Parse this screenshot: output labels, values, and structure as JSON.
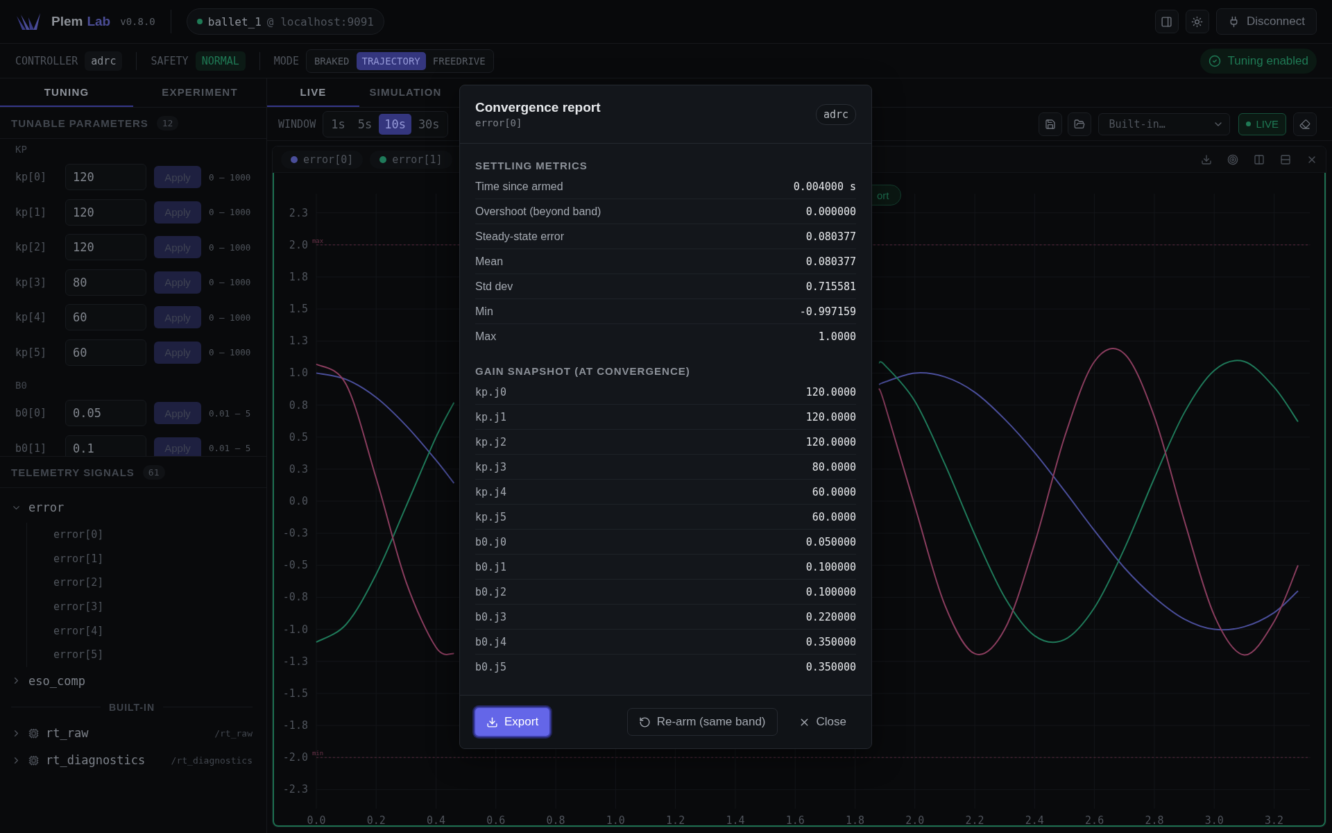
{
  "header": {
    "brand": "Plem",
    "brand_accent": "Lab",
    "version": "v0.8.0",
    "connection": {
      "robot": "ballet_1",
      "separator": "@",
      "host": "localhost:9091",
      "connected": true
    },
    "disconnect": "Disconnect"
  },
  "status_bar": {
    "controller_label": "CONTROLLER",
    "controller": "adrc",
    "safety_label": "SAFETY",
    "safety": "NORMAL",
    "mode_label": "MODE",
    "modes": [
      {
        "label": "BRAKED",
        "selected": false
      },
      {
        "label": "TRAJECTORY",
        "selected": true
      },
      {
        "label": "FREEDRIVE",
        "selected": false
      }
    ],
    "tuning": {
      "label": "Tuning enabled",
      "on": true
    }
  },
  "sidebar": {
    "tabs": [
      {
        "label": "TUNING",
        "selected": true
      },
      {
        "label": "EXPERIMENT",
        "selected": false
      }
    ],
    "parameters": {
      "title": "TUNABLE PARAMETERS",
      "count": "12",
      "groups": [
        {
          "label": "KP",
          "items": [
            {
              "name": "kp[0]",
              "value": "120",
              "button": "Apply",
              "disabled": true,
              "range": "0 – 1000"
            },
            {
              "name": "kp[1]",
              "value": "120",
              "button": "Apply",
              "disabled": true,
              "range": "0 – 1000"
            },
            {
              "name": "kp[2]",
              "value": "120",
              "button": "Apply",
              "disabled": true,
              "range": "0 – 1000"
            },
            {
              "name": "kp[3]",
              "value": "80",
              "button": "Apply",
              "disabled": true,
              "range": "0 – 1000"
            },
            {
              "name": "kp[4]",
              "value": "60",
              "button": "Apply",
              "disabled": true,
              "range": "0 – 1000"
            },
            {
              "name": "kp[5]",
              "value": "60",
              "button": "Apply",
              "disabled": true,
              "range": "0 – 1000"
            }
          ]
        },
        {
          "label": "B0",
          "items": [
            {
              "name": "b0[0]",
              "value": "0.05",
              "button": "Apply",
              "disabled": true,
              "range": "0.01 – 5"
            },
            {
              "name": "b0[1]",
              "value": "0.1",
              "button": "Apply",
              "disabled": true,
              "range": "0.01 – 5"
            }
          ]
        }
      ]
    },
    "signals": {
      "title": "TELEMETRY SIGNALS",
      "count": "61",
      "groups": [
        {
          "label": "error",
          "expanded": true,
          "children": [
            {
              "label": "error[0]"
            },
            {
              "label": "error[1]"
            },
            {
              "label": "error[2]"
            },
            {
              "label": "error[3]"
            },
            {
              "label": "error[4]"
            },
            {
              "label": "error[5]"
            }
          ]
        },
        {
          "label": "eso_comp",
          "expanded": false
        }
      ],
      "builtin_label": "BUILT-IN",
      "builtin": [
        {
          "label": "rt_raw",
          "path": "/rt_raw",
          "expanded": false
        },
        {
          "label": "rt_diagnostics",
          "path": "/rt_diagnostics",
          "expanded": false
        }
      ]
    }
  },
  "main": {
    "tabs": [
      {
        "label": "LIVE",
        "selected": true
      },
      {
        "label": "SIMULATION",
        "selected": false
      }
    ],
    "toolbar": {
      "window_label": "WINDOW",
      "windows": [
        {
          "label": "1s",
          "selected": false
        },
        {
          "label": "5s",
          "selected": false
        },
        {
          "label": "10s",
          "selected": true
        },
        {
          "label": "30s",
          "selected": false
        }
      ],
      "preset": "Built-in…",
      "live": {
        "label": "LIVE",
        "on": true
      }
    },
    "chart": {
      "badge": "ort",
      "chart_data": {
        "type": "line",
        "xlim": [
          0,
          3.32
        ],
        "ylim": [
          -2.4,
          2.4
        ],
        "xticks": [
          {
            "value": 0,
            "label": "0.0"
          },
          {
            "value": 0.2,
            "label": "0.2"
          },
          {
            "value": 0.4,
            "label": "0.4"
          },
          {
            "value": 0.6,
            "label": "0.6"
          },
          {
            "value": 0.8,
            "label": "0.8"
          },
          {
            "value": 1,
            "label": "1.0"
          },
          {
            "value": 1.2,
            "label": "1.2"
          },
          {
            "value": 1.4,
            "label": "1.4"
          },
          {
            "value": 1.6,
            "label": "1.6"
          },
          {
            "value": 1.8,
            "label": "1.8"
          },
          {
            "value": 2,
            "label": "2.0"
          },
          {
            "value": 2.2,
            "label": "2.2"
          },
          {
            "value": 2.4,
            "label": "2.4"
          },
          {
            "value": 2.6,
            "label": "2.6"
          },
          {
            "value": 2.8,
            "label": "2.8"
          },
          {
            "value": 3,
            "label": "3.0"
          },
          {
            "value": 3.2,
            "label": "3.2"
          }
        ],
        "yticks": [
          {
            "value": 2.25,
            "label": "2.3"
          },
          {
            "value": 2,
            "label": "2.0"
          },
          {
            "value": 1.75,
            "label": "1.8"
          },
          {
            "value": 1.5,
            "label": "1.5"
          },
          {
            "value": 1.25,
            "label": "1.3"
          },
          {
            "value": 1,
            "label": "1.0"
          },
          {
            "value": 0.75,
            "label": "0.8"
          },
          {
            "value": 0.5,
            "label": "0.5"
          },
          {
            "value": 0.25,
            "label": "0.3"
          },
          {
            "value": 0,
            "label": "0.0"
          },
          {
            "value": -0.25,
            "label": "-0.3"
          },
          {
            "value": -0.5,
            "label": "-0.5"
          },
          {
            "value": -0.75,
            "label": "-0.8"
          },
          {
            "value": -1,
            "label": "-1.0"
          },
          {
            "value": -1.25,
            "label": "-1.3"
          },
          {
            "value": -1.5,
            "label": "-1.5"
          },
          {
            "value": -1.75,
            "label": "-1.8"
          },
          {
            "value": -2,
            "label": "-2.0"
          },
          {
            "value": -2.25,
            "label": "-2.3"
          }
        ],
        "grid": true,
        "annotations": [
          "max",
          "min"
        ],
        "x": [
          0,
          0.1,
          0.2,
          0.3,
          0.4,
          0.46,
          1.88,
          1.9,
          2,
          2.1,
          2.2,
          2.3,
          2.4,
          2.5,
          2.6,
          2.7,
          2.8,
          2.9,
          3,
          3.1,
          3.2,
          3.28
        ],
        "series": [
          {
            "name": "error[0]",
            "color": "#4a4e9a",
            "values": [
              1,
              0.95,
              0.81,
              0.59,
              0.32,
              0.14,
              0.91,
              0.93,
              1,
              0.97,
              0.85,
              0.64,
              0.38,
              0.08,
              -0.23,
              -0.52,
              -0.75,
              -0.92,
              -1,
              -0.98,
              -0.87,
              -0.7
            ]
          },
          {
            "name": "error[1]",
            "color": "#1f7a5a",
            "values": [
              -1.1,
              -0.96,
              -0.57,
              -0.04,
              0.5,
              0.77,
              1.08,
              1.06,
              0.78,
              0.29,
              -0.26,
              -0.75,
              -1.05,
              -1.08,
              -0.83,
              -0.37,
              0.18,
              0.69,
              1.02,
              1.09,
              0.89,
              0.62
            ]
          },
          {
            "color": "#8a3d5e",
            "values": [
              1.07,
              0.91,
              0.18,
              -0.63,
              -1.14,
              -1.19,
              0.88,
              0.75,
              -0.04,
              -0.81,
              -1.19,
              -1,
              -0.33,
              0.5,
              1.09,
              1.15,
              0.66,
              -0.15,
              -0.89,
              -1.2,
              -0.94,
              -0.5
            ]
          }
        ]
      }
    }
  },
  "dialog": {
    "title": "Convergence report",
    "subtitle": "error[0]",
    "tag": "adrc",
    "sections": [
      {
        "title": "SETTLING METRICS",
        "kind": "metrics",
        "rows": [
          {
            "label": "Time since armed",
            "value": "0.004000 s"
          },
          {
            "label": "Overshoot (beyond band)",
            "value": "0.000000"
          },
          {
            "label": "Steady-state error",
            "value": "0.080377"
          },
          {
            "label": "Mean",
            "value": "0.080377"
          },
          {
            "label": "Std dev",
            "value": "0.715581"
          },
          {
            "label": "Min",
            "value": "-0.997159"
          },
          {
            "label": "Max",
            "value": "1.0000"
          }
        ]
      },
      {
        "title": "GAIN SNAPSHOT (AT CONVERGENCE)",
        "kind": "gains",
        "rows": [
          {
            "label": "kp.j0",
            "value": "120.0000"
          },
          {
            "label": "kp.j1",
            "value": "120.0000"
          },
          {
            "label": "kp.j2",
            "value": "120.0000"
          },
          {
            "label": "kp.j3",
            "value": "80.0000"
          },
          {
            "label": "kp.j4",
            "value": "60.0000"
          },
          {
            "label": "kp.j5",
            "value": "60.0000"
          },
          {
            "label": "b0.j0",
            "value": "0.050000"
          },
          {
            "label": "b0.j1",
            "value": "0.100000"
          },
          {
            "label": "b0.j2",
            "value": "0.100000"
          },
          {
            "label": "b0.j3",
            "value": "0.220000"
          },
          {
            "label": "b0.j4",
            "value": "0.350000"
          },
          {
            "label": "b0.j5",
            "value": "0.350000"
          }
        ]
      }
    ],
    "actions": [
      {
        "label": "Export",
        "kind": "primary"
      },
      {
        "label": "Re-arm (same band)",
        "kind": "outline"
      },
      {
        "label": "Close",
        "kind": "ghost"
      }
    ]
  }
}
